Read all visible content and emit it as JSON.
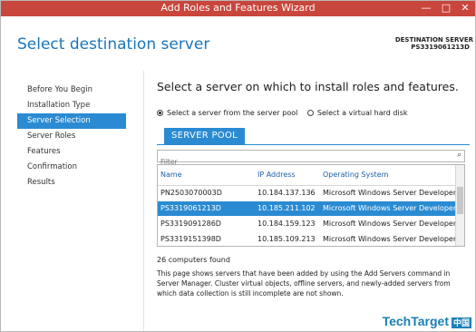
{
  "window": {
    "title": "Add Roles and Features Wizard",
    "controls": {
      "minimize": "—",
      "maximize": "□",
      "close": "✕"
    }
  },
  "header": {
    "page_title": "Select destination server",
    "destination_label": "DESTINATION SERVER",
    "destination_value": "PS3319061213D"
  },
  "nav": {
    "items": [
      {
        "label": "Before You Begin",
        "active": false
      },
      {
        "label": "Installation Type",
        "active": false
      },
      {
        "label": "Server Selection",
        "active": true
      },
      {
        "label": "Server Roles",
        "active": false
      },
      {
        "label": "Features",
        "active": false
      },
      {
        "label": "Confirmation",
        "active": false
      },
      {
        "label": "Results",
        "active": false
      }
    ]
  },
  "main": {
    "headline": "Select a server on which to install roles and features.",
    "radio_pool": "Select a server from the server pool",
    "radio_vhd": "Select a virtual hard disk",
    "pool_tab": "SERVER POOL",
    "filter_placeholder": "Filter",
    "columns": [
      "Name",
      "IP Address",
      "Operating System"
    ],
    "rows": [
      {
        "name": "PN2503070003D",
        "ip": "10.184.137.136",
        "os": "Microsoft Windows Server Developer Pr",
        "selected": false
      },
      {
        "name": "PS3319061213D",
        "ip": "10.185.211.102",
        "os": "Microsoft Windows Server Developer Pr",
        "selected": true
      },
      {
        "name": "PS3319091286D",
        "ip": "10.184.159.123",
        "os": "Microsoft Windows Server Developer Pr",
        "selected": false
      },
      {
        "name": "PS3319151398D",
        "ip": "10.185.109.213",
        "os": "Microsoft Windows Server Developer Pr",
        "selected": false
      }
    ],
    "count_text": "26 computers found",
    "description": "This page shows servers that have been added by using the Add Servers command in Server Manager.  Cluster virtual objects, offline servers, and newly-added servers from which data collection is still incomplete are not shown."
  },
  "watermark": {
    "brand": "TechTarget",
    "cn": "中国"
  },
  "icons": {
    "filter": "search-icon"
  },
  "colors": {
    "title_bar": "#c8463c",
    "accent": "#2a8bd2",
    "title_text": "#1b75bb"
  }
}
